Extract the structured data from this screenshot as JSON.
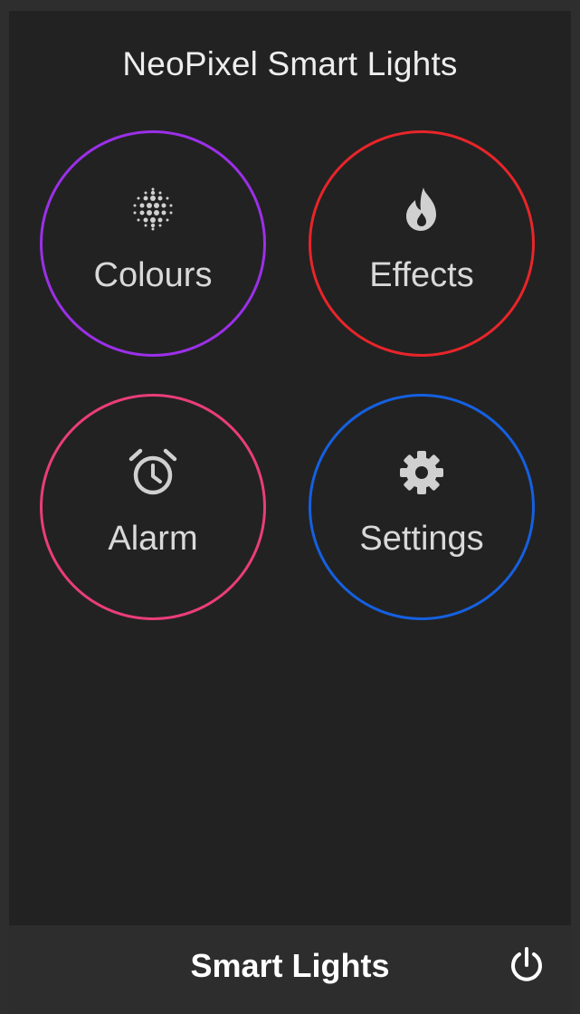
{
  "header": {
    "title": "NeoPixel Smart Lights"
  },
  "menu": {
    "items": [
      {
        "label": "Colours",
        "icon": "dot-grid-icon",
        "color": "#9b30e8"
      },
      {
        "label": "Effects",
        "icon": "fire-icon",
        "color": "#e8252a"
      },
      {
        "label": "Alarm",
        "icon": "alarm-clock-icon",
        "color": "#ea3d7a"
      },
      {
        "label": "Settings",
        "icon": "gear-icon",
        "color": "#1560e0"
      }
    ]
  },
  "footer": {
    "title": "Smart Lights",
    "power_icon": "power-icon"
  },
  "colors": {
    "background": "#222222",
    "text": "#d9d9d9",
    "icon": "#d0d0d0"
  }
}
